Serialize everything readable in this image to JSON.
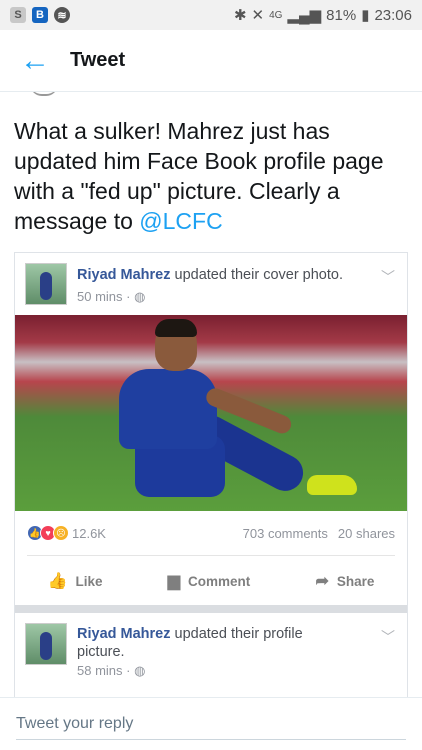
{
  "status": {
    "left_icons": [
      "S",
      "B",
      "spotify-icon"
    ],
    "network": "4G",
    "battery": "81%",
    "time": "23:06"
  },
  "appbar": {
    "title": "Tweet"
  },
  "tweet": {
    "text": "What a sulker! Mahrez just has updated him Face Book profile page with a \"fed up\" picture. Clearly a message to ",
    "mention": "@LCFC"
  },
  "post1": {
    "author": "Riyad Mahrez",
    "action": " updated their cover photo.",
    "time": "50 mins · ",
    "reactions_count": "12.6K",
    "comments": "703 comments",
    "shares": "20 shares",
    "actions": [
      "Like",
      "Comment",
      "Share"
    ]
  },
  "post2": {
    "author": "Riyad Mahrez",
    "action": " updated their profile picture.",
    "time": "58 mins · "
  },
  "reply": {
    "placeholder": "Tweet your reply"
  },
  "colors": {
    "accent": "#1da1f2",
    "fb_link": "#365899"
  }
}
